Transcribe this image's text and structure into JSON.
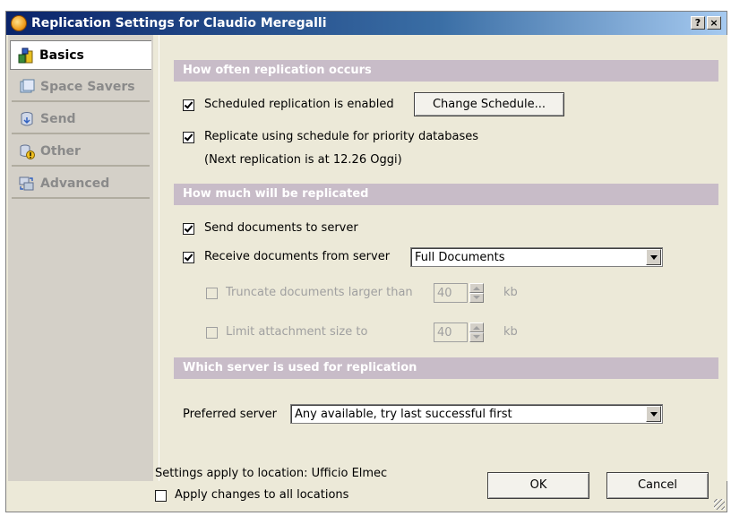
{
  "window": {
    "title": "Replication Settings for Claudio Meregalli",
    "help_label": "?",
    "close_label": "×"
  },
  "sidebar": {
    "items": [
      {
        "label": "Basics",
        "icon": "basics-icon",
        "active": true
      },
      {
        "label": "Space Savers",
        "icon": "space-savers-icon",
        "active": false
      },
      {
        "label": "Send",
        "icon": "send-icon",
        "active": false
      },
      {
        "label": "Other",
        "icon": "other-icon",
        "active": false
      },
      {
        "label": "Advanced",
        "icon": "advanced-icon",
        "active": false
      }
    ]
  },
  "sections": {
    "how_often": {
      "header": "How often replication occurs",
      "scheduled_label": "Scheduled replication is enabled",
      "scheduled_checked": true,
      "change_schedule_label": "Change Schedule...",
      "priority_label": "Replicate using schedule for priority databases",
      "priority_checked": true,
      "next_replication": "(Next replication is at 12.26 Oggi)"
    },
    "how_much": {
      "header": "How much will be replicated",
      "send_label": "Send documents to server",
      "send_checked": true,
      "receive_label": "Receive documents from server",
      "receive_checked": true,
      "receive_option": "Full Documents",
      "truncate_label": "Truncate documents larger than",
      "truncate_value": "40",
      "truncate_unit": "kb",
      "limit_label": "Limit attachment size to",
      "limit_value": "40",
      "limit_unit": "kb"
    },
    "which_server": {
      "header": "Which server is used for replication",
      "preferred_label": "Preferred server",
      "preferred_value": "Any available, try last successful first"
    }
  },
  "footer": {
    "location_text": "Settings apply to location: Ufficio Elmec",
    "apply_all_label": "Apply changes to all locations",
    "apply_all_checked": false,
    "ok_label": "OK",
    "cancel_label": "Cancel"
  }
}
